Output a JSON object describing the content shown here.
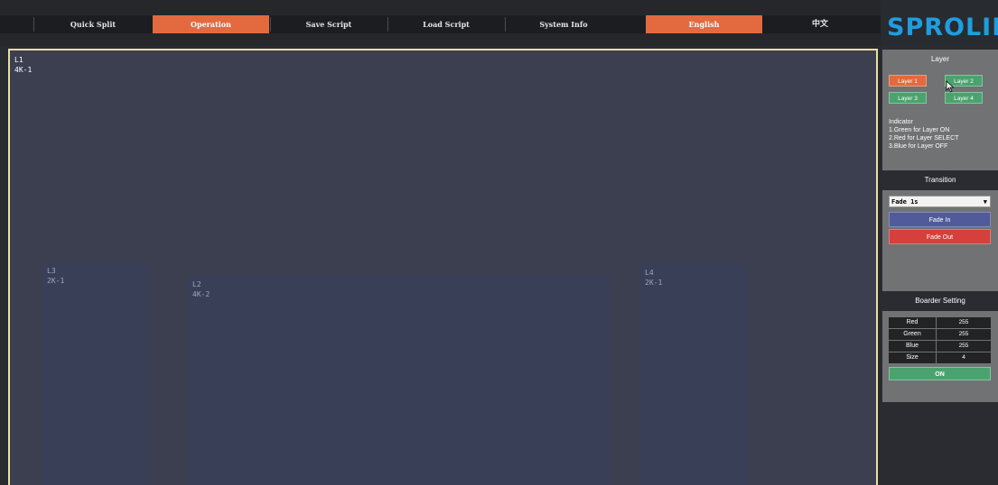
{
  "nav": {
    "items": [
      "Quick Split",
      "Operation",
      "Save Script",
      "Load Script",
      "System Info",
      "English",
      "中文"
    ],
    "active": [
      "Operation",
      "English"
    ]
  },
  "logo": {
    "text": "SPROLINK",
    "mark": "®"
  },
  "canvas": {
    "main_layer": {
      "id": "L1",
      "resolution": "4K-1"
    },
    "layers": [
      {
        "id": "L3",
        "resolution": "2K-1"
      },
      {
        "id": "L2",
        "resolution": "4K-2"
      },
      {
        "id": "L4",
        "resolution": "2K-1"
      }
    ]
  },
  "layer_panel": {
    "title": "Layer",
    "buttons": [
      "Layer 1",
      "Layer 2",
      "Layer 3",
      "Layer 4"
    ],
    "indicator": [
      "Indicator",
      "1.Green for Layer ON",
      "2.Red for Layer SELECT",
      "3.Blue for Layer OFF"
    ]
  },
  "transition_panel": {
    "title": "Transition",
    "selected": "Fade 1s",
    "fade_in": "Fade In",
    "fade_out": "Fade Out"
  },
  "border_panel": {
    "title": "Boarder Setting",
    "rows": [
      {
        "label": "Red",
        "value": "255"
      },
      {
        "label": "Green",
        "value": "255"
      },
      {
        "label": "Blue",
        "value": "255"
      },
      {
        "label": "Size",
        "value": "4"
      }
    ],
    "toggle": "ON"
  },
  "colors": {
    "accent_orange": "#e26a3e",
    "layer_on_green": "#4aa36e",
    "fade_in_blue": "#515b9b",
    "fade_out_red": "#d5403c",
    "logo_blue": "#1e9ee0",
    "canvas_border": "#e9e0a0"
  },
  "icons": {
    "dropdown": "chevron-down-icon",
    "cursor": "mouse-pointer-icon"
  }
}
